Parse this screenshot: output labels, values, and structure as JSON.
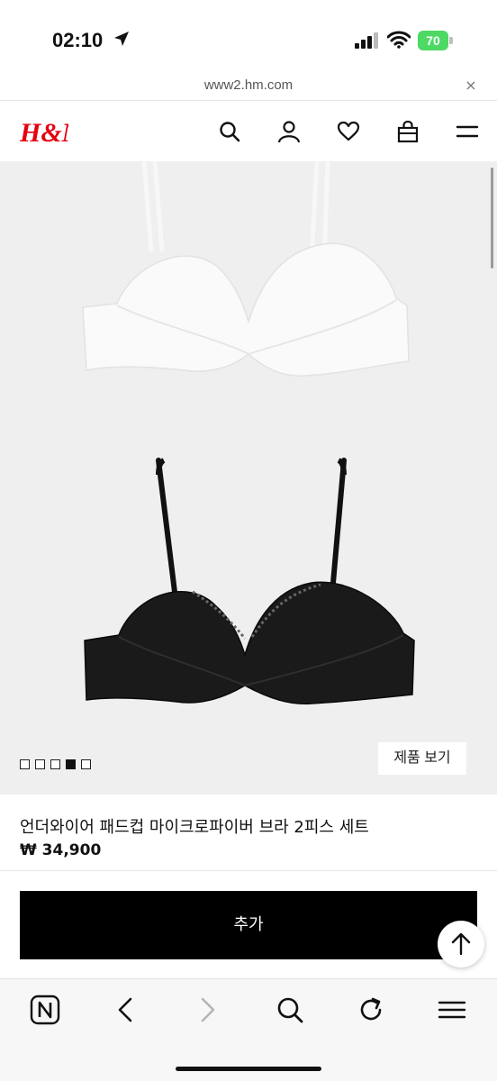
{
  "status_bar": {
    "time": "02:10",
    "battery_level": "70"
  },
  "url_bar": {
    "url": "www2.hm.com",
    "close_label": "×"
  },
  "header": {
    "logo_text": "H&M",
    "icons": [
      "search-icon",
      "account-icon",
      "favorites-icon",
      "shopping-bag-icon",
      "menu-icon"
    ]
  },
  "gallery": {
    "image_count": 5,
    "active_index": 3,
    "view_product_label": "제품 보기"
  },
  "product": {
    "title": "언더와이어 패드컵 마이크로파이버 브라 2피스 세트",
    "price": "₩ 34,900"
  },
  "actions": {
    "add_label": "추가"
  },
  "toolbar": {
    "icons": [
      "naver-home-icon",
      "back-icon",
      "forward-icon",
      "search-icon",
      "reload-icon",
      "menu-icon"
    ]
  },
  "colors": {
    "brand_red": "#e50010",
    "battery_green": "#4cd964",
    "button_black": "#000000"
  }
}
